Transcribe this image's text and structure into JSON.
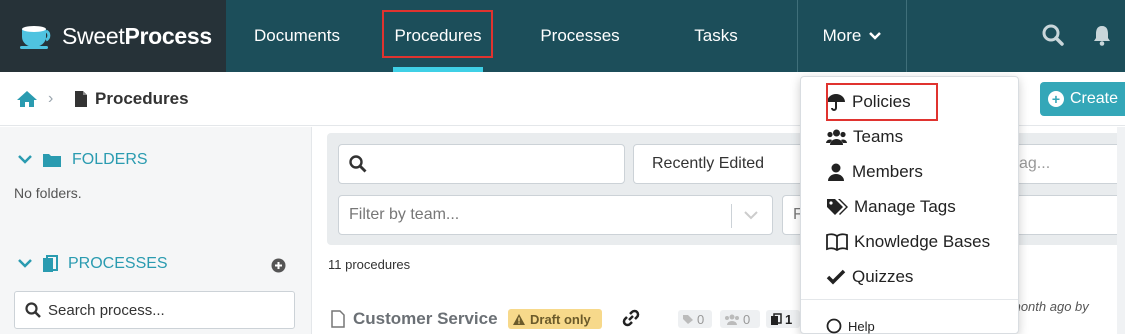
{
  "app": {
    "logo_part1": "Sweet",
    "logo_part2": "Process"
  },
  "nav": {
    "documents": "Documents",
    "procedures": "Procedures",
    "processes": "Processes",
    "tasks": "Tasks",
    "more": "More"
  },
  "breadcrumb": {
    "title": "Procedures"
  },
  "toolbar": {
    "create_label": "Create"
  },
  "sidebar": {
    "folders_label": "FOLDERS",
    "no_folders": "No folders.",
    "processes_label": "PROCESSES",
    "search_placeholder": "Search process..."
  },
  "filters": {
    "sort_value": "Recently Edited",
    "tag_partial": "ag...",
    "team_placeholder": "Filter by team...",
    "partial_second": "F"
  },
  "list": {
    "count_label": "11 procedures",
    "first_row": {
      "title": "Customer Service",
      "badge": "Draft only",
      "tags": "0",
      "teams": "0",
      "docs": "1",
      "meta": "month ago by"
    }
  },
  "more_menu": {
    "items": [
      {
        "label": "Policies",
        "icon": "umbrella-icon"
      },
      {
        "label": "Teams",
        "icon": "users-icon"
      },
      {
        "label": "Members",
        "icon": "user-icon"
      },
      {
        "label": "Manage Tags",
        "icon": "tags-icon"
      },
      {
        "label": "Knowledge Bases",
        "icon": "book-icon"
      },
      {
        "label": "Quizzes",
        "icon": "check-icon"
      }
    ],
    "help_label": "Help"
  },
  "colors": {
    "topbar": "#1c4e5a",
    "logo_bg": "#263238",
    "accent": "#2a9bb0",
    "highlight": "#e0332f",
    "draft": "#f7d98b"
  }
}
